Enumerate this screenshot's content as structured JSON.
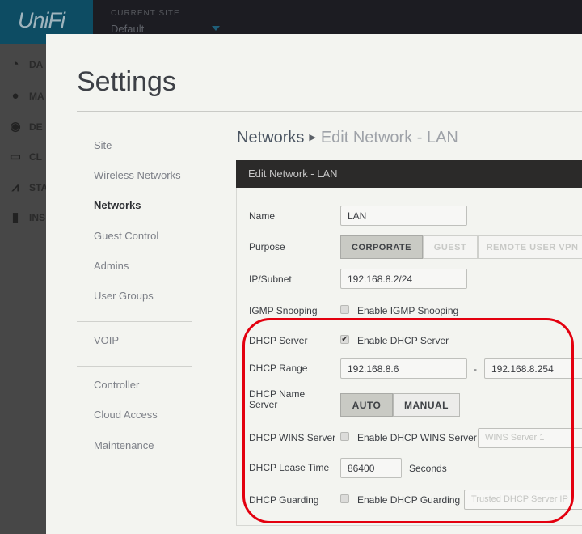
{
  "app": {
    "logo": "UniFi",
    "current_site_label": "CURRENT SITE",
    "current_site": "Default"
  },
  "nav": [
    {
      "icon": "dashboard-icon",
      "label": "DA"
    },
    {
      "icon": "map-pin-icon",
      "label": "MA"
    },
    {
      "icon": "devices-icon",
      "label": "DE"
    },
    {
      "icon": "laptop-icon",
      "label": "CL"
    },
    {
      "icon": "stats-icon",
      "label": "STA"
    },
    {
      "icon": "insights-icon",
      "label": "INS"
    }
  ],
  "settings": {
    "title": "Settings",
    "menu": [
      "Site",
      "Wireless Networks",
      "Networks",
      "Guest Control",
      "Admins",
      "User Groups",
      "VOIP",
      "Controller",
      "Cloud Access",
      "Maintenance"
    ],
    "active_menu": "Networks"
  },
  "breadcrumb": {
    "parent": "Networks",
    "current": "Edit Network - LAN"
  },
  "panel": {
    "title": "Edit Network - LAN"
  },
  "form": {
    "name_label": "Name",
    "name_value": "LAN",
    "purpose_label": "Purpose",
    "purpose_options": [
      "CORPORATE",
      "GUEST",
      "REMOTE USER VPN"
    ],
    "purpose_selected": "CORPORATE",
    "subnet_label": "IP/Subnet",
    "subnet_value": "192.168.8.2/24",
    "igmp_label": "IGMP Snooping",
    "igmp_checkbox": "Enable IGMP Snooping",
    "igmp_checked": false,
    "dhcp_server_label": "DHCP Server",
    "dhcp_server_checkbox": "Enable DHCP Server",
    "dhcp_server_checked": true,
    "dhcp_range_label": "DHCP Range",
    "dhcp_range_start": "192.168.8.6",
    "dhcp_range_sep": "-",
    "dhcp_range_end": "192.168.8.254",
    "dhcp_ns_label": "DHCP Name Server",
    "dhcp_ns_options": [
      "AUTO",
      "MANUAL"
    ],
    "dhcp_ns_selected": "AUTO",
    "wins_label": "DHCP WINS Server",
    "wins_checkbox": "Enable DHCP WINS Server",
    "wins_checked": false,
    "wins_placeholder": "WINS Server 1",
    "lease_label": "DHCP Lease Time",
    "lease_value": "86400",
    "lease_unit": "Seconds",
    "guard_label": "DHCP Guarding",
    "guard_checkbox": "Enable DHCP Guarding",
    "guard_checked": false,
    "guard_placeholder": "Trusted DHCP Server IP"
  },
  "colors": {
    "highlight": "#e3000f",
    "logo_bg": "#0d4c63",
    "panel_header": "#2b2a29"
  }
}
